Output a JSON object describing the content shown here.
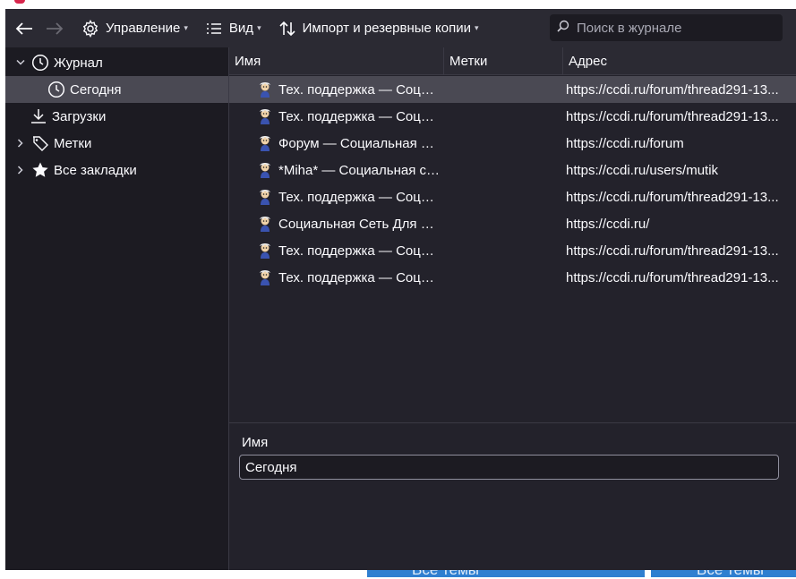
{
  "toolbar": {
    "manage_label": "Управление",
    "view_label": "Вид",
    "import_label": "Импорт и резервные копии"
  },
  "search": {
    "placeholder": "Поиск в журнале"
  },
  "sidebar": {
    "items": [
      {
        "label": "Журнал",
        "icon": "clock-icon"
      },
      {
        "label": "Сегодня",
        "icon": "clock-icon"
      },
      {
        "label": "Загрузки",
        "icon": "download-icon"
      },
      {
        "label": "Метки",
        "icon": "tag-icon"
      },
      {
        "label": "Все закладки",
        "icon": "star-icon"
      }
    ]
  },
  "columns": {
    "name": "Имя",
    "tags": "Метки",
    "url": "Адрес"
  },
  "rows": [
    {
      "name": "Тех. поддержка — Социальная сеть",
      "url": "https://ccdi.ru/forum/thread291-13..."
    },
    {
      "name": "Тех. поддержка — Социальная сеть",
      "url": "https://ccdi.ru/forum/thread291-13..."
    },
    {
      "name": "Форум — Социальная сеть",
      "url": "https://ccdi.ru/forum"
    },
    {
      "name": "*Miha* — Социальная сеть",
      "url": "https://ccdi.ru/users/mutik"
    },
    {
      "name": "Тех. поддержка — Социальная сеть",
      "url": "https://ccdi.ru/forum/thread291-13..."
    },
    {
      "name": "Социальная Сеть Для Инвалидов",
      "url": "https://ccdi.ru/"
    },
    {
      "name": "Тех. поддержка — Социальная сеть",
      "url": "https://ccdi.ru/forum/thread291-13..."
    },
    {
      "name": "Тех. поддержка — Социальная сеть",
      "url": "https://ccdi.ru/forum/thread291-13..."
    }
  ],
  "details": {
    "name_label": "Имя",
    "name_value": "Сегодня"
  },
  "background": {
    "window_title_1": "Все темы",
    "window_title_2": "Все темы"
  },
  "colors": {
    "window_bg": "#1c1b22",
    "toolbar_bg": "#2b2a33",
    "selection": "#4a4953",
    "text": "#fbfbfe"
  }
}
